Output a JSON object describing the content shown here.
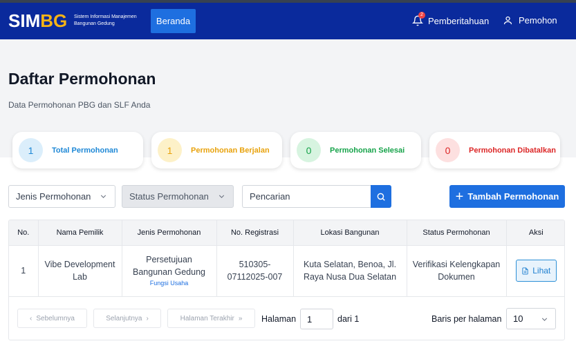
{
  "navbar": {
    "logo_sim": "SIM",
    "logo_bg": "BG",
    "logo_sub_line1": "Sistem Informasi Manajemen",
    "logo_sub_line2": "Bangunan Gedung",
    "home_label": "Beranda",
    "notification_label": "Pemberitahuan",
    "notification_count": "2",
    "user_label": "Pemohon"
  },
  "header": {
    "title": "Daftar Permohonan",
    "subtitle": "Data Permohonan PBG dan SLF Anda"
  },
  "stats": [
    {
      "value": "1",
      "label": "Total Permohonan",
      "color": "#1e88d6",
      "bg": "#dbeefb"
    },
    {
      "value": "1",
      "label": "Permohonan Berjalan",
      "color": "#e8a20c",
      "bg": "#fdf1c8"
    },
    {
      "value": "0",
      "label": "Permohonan Selesai",
      "color": "#16a34a",
      "bg": "#d7f4e0"
    },
    {
      "value": "0",
      "label": "Permohonan Dibatalkan",
      "color": "#dc2626",
      "bg": "#fde0e0"
    }
  ],
  "filters": {
    "type_placeholder": "Jenis Permohonan",
    "status_placeholder": "Status Permohonan",
    "search_placeholder": "Pencarian",
    "add_label": "Tambah Permohonan"
  },
  "table": {
    "headers": [
      "No.",
      "Nama Pemilik",
      "Jenis Permohonan",
      "No. Registrasi",
      "Lokasi Bangunan",
      "Status Permohonan",
      "Aksi"
    ],
    "rows": [
      {
        "no": "1",
        "owner": "Vibe Development Lab",
        "type": "Persetujuan Bangunan Gedung",
        "usage": "Fungsi Usaha",
        "registration": "510305-07112025-007",
        "location": "Kuta Selatan, Benoa, Jl. Raya Nusa Dua Selatan",
        "status": "Verifikasi Kelengkapan Dokumen",
        "action": "Lihat"
      }
    ]
  },
  "pagination": {
    "prev": "Sebelumnya",
    "next": "Selanjutnya",
    "last": "Halaman Terakhir",
    "page_label": "Halaman",
    "page_value": "1",
    "of_label": "dari 1",
    "rows_label": "Baris per halaman",
    "rows_value": "10"
  }
}
